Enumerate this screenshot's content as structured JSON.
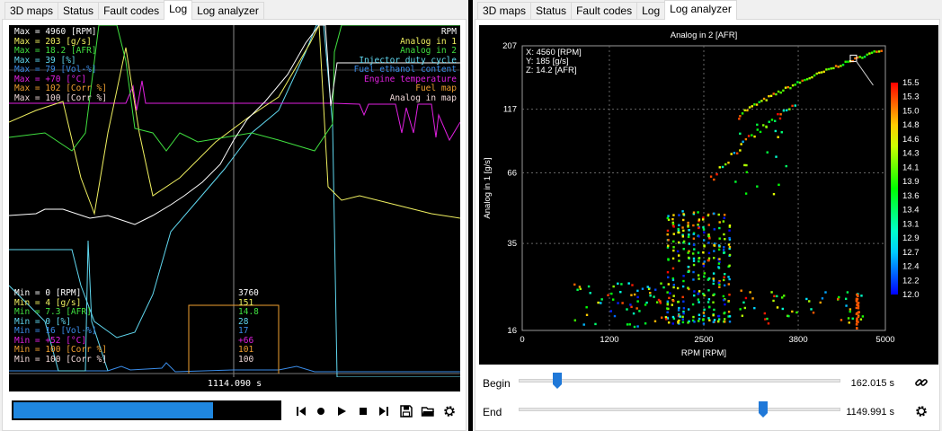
{
  "tabs_left": [
    {
      "label": "3D maps",
      "active": false
    },
    {
      "label": "Status",
      "active": false
    },
    {
      "label": "Fault codes",
      "active": false
    },
    {
      "label": "Log",
      "active": true
    },
    {
      "label": "Log analyzer",
      "active": false
    }
  ],
  "tabs_right": [
    {
      "label": "3D maps",
      "active": false
    },
    {
      "label": "Status",
      "active": false
    },
    {
      "label": "Fault codes",
      "active": false
    },
    {
      "label": "Log",
      "active": false
    },
    {
      "label": "Log analyzer",
      "active": true
    }
  ],
  "log": {
    "channels": [
      {
        "name": "RPM",
        "color": "#ffffff",
        "max": "Max = 4960 [RPM]",
        "min": "Min = 0 [RPM]",
        "cursor": "3760"
      },
      {
        "name": "Analog in 1",
        "color": "#f0f060",
        "max": "Max = 203 [g/s]",
        "min": "Min = 4 [g/s]",
        "cursor": "151"
      },
      {
        "name": "Analog in 2",
        "color": "#40e040",
        "max": "Max = 18.2 [AFR]",
        "min": "Min = 7.3 [AFR]",
        "cursor": "14.8"
      },
      {
        "name": "Injector duty cycle",
        "color": "#60d8f0",
        "max": "Max = 39 [%]",
        "min": "Min = 0 [%]",
        "cursor": "28"
      },
      {
        "name": "Fuel ethanol content",
        "color": "#3a8ce8",
        "max": "Max = 79 [Vol-%]",
        "min": "Min = 16 [Vol-%]",
        "cursor": "17"
      },
      {
        "name": "Engine temperature",
        "color": "#e020e0",
        "max": "Max = +70 [°C]",
        "min": "Min = +52 [°C]",
        "cursor": "+66"
      },
      {
        "name": "Fuel map",
        "color": "#f0a030",
        "max": "Max = 102 [Corr %]",
        "min": "Min = 100 [Corr %]",
        "cursor": "101"
      },
      {
        "name": "Analog in map",
        "color": "#f0d8d8",
        "max": "Max = 100 [Corr %]",
        "min": "Min = 100 [Corr %]",
        "cursor": "100"
      }
    ],
    "cursor_time": "1114.090 s",
    "progress": 0.75
  },
  "controls": {
    "skip_back": "skip-to-start-icon",
    "record": "record-icon",
    "play": "play-icon",
    "stop": "stop-icon",
    "skip_forward": "skip-to-end-icon",
    "save": "save-icon",
    "open": "open-folder-icon",
    "settings": "gear-icon"
  },
  "chart_data": {
    "type": "scatter",
    "title": "Analog in 2 [AFR]",
    "xlabel": "RPM [RPM]",
    "ylabel": "Analog in 1 [g/s]",
    "x_ticks": [
      "0",
      "1200",
      "2500",
      "3800",
      "5000"
    ],
    "x_tick_values": [
      0,
      1200,
      2500,
      3800,
      5000
    ],
    "y_ticks": [
      "207",
      "117",
      "66",
      "35",
      "16"
    ],
    "y_tick_values": [
      207,
      117,
      66,
      35,
      16
    ],
    "y_scale": "log",
    "xlim": [
      0,
      5000
    ],
    "ylim": [
      16,
      207
    ],
    "grid": true,
    "colorbar": {
      "ticks": [
        "15.5",
        "15.3",
        "15.0",
        "14.8",
        "14.6",
        "14.3",
        "14.1",
        "13.9",
        "13.6",
        "13.4",
        "13.1",
        "12.9",
        "12.7",
        "12.4",
        "12.2",
        "12.0"
      ],
      "range": [
        12.0,
        15.5
      ],
      "placement": "right"
    },
    "readout": {
      "x": "X: 4560 [RPM]",
      "y": "Y: 185 [g/s]",
      "z": "Z: 14.2 [AFR]"
    },
    "highlight": {
      "x": 4560,
      "y": 185,
      "z": 14.2
    }
  },
  "sliders": {
    "begin_label": "Begin",
    "begin_value": "162.015 s",
    "begin_fraction": 0.12,
    "end_label": "End",
    "end_value": "1149.991 s",
    "end_fraction": 0.76,
    "link_icon": "link-icon",
    "settings_icon": "gear-icon"
  }
}
